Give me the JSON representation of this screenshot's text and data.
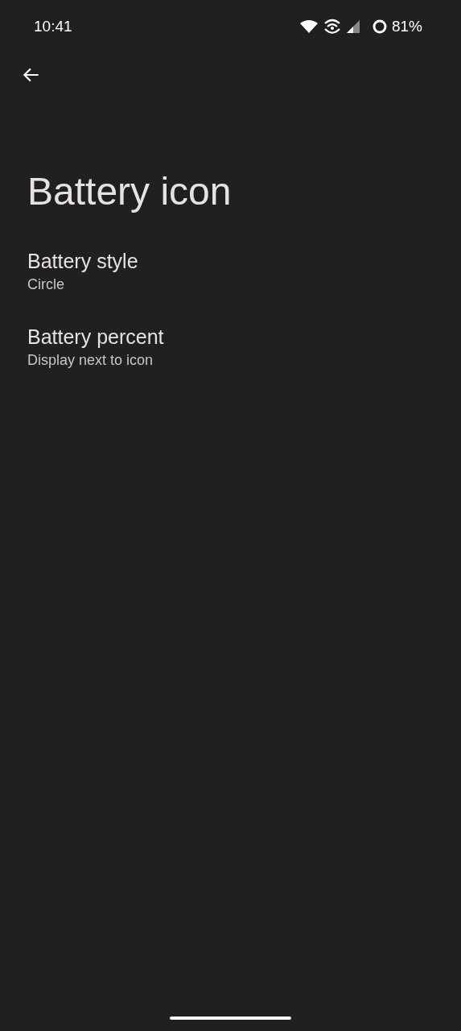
{
  "status_bar": {
    "time": "10:41",
    "battery_percent": "81%"
  },
  "title": "Battery icon",
  "settings": [
    {
      "title": "Battery style",
      "summary": "Circle"
    },
    {
      "title": "Battery percent",
      "summary": "Display next to icon"
    }
  ]
}
